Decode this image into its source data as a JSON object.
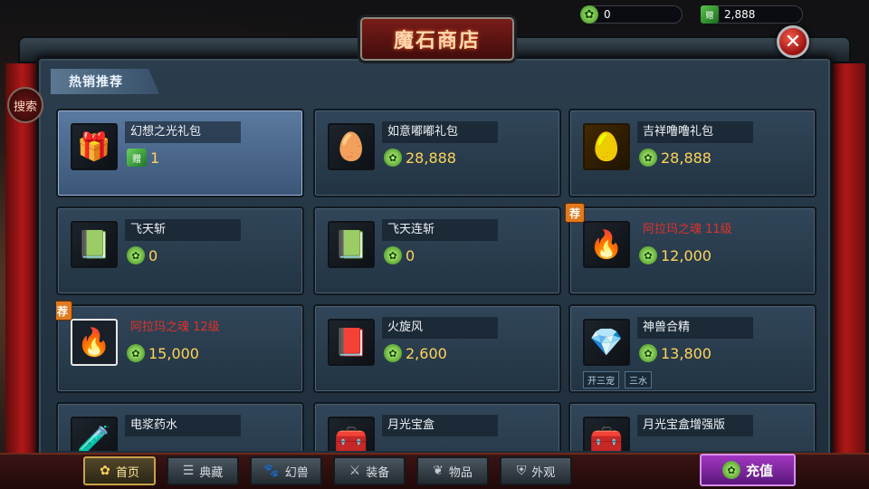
{
  "title": "魔石商店",
  "currency": {
    "gem": "0",
    "gift_gem": "2,888"
  },
  "search_label": "搜索",
  "section": "热销推荐",
  "colors": {
    "price": "#ffd35a",
    "red_name": "#e0322a",
    "badge": "#e07a1e",
    "recharge": "#a236c2"
  },
  "items": [
    {
      "name": "幻想之光礼包",
      "price": "1",
      "icon": "gift-box-icon",
      "currency": "gift",
      "selected": true
    },
    {
      "name": "如意嘟嘟礼包",
      "price": "28,888",
      "icon": "white-egg-icon"
    },
    {
      "name": "吉祥噜噜礼包",
      "price": "28,888",
      "icon": "golden-egg-icon"
    },
    {
      "name": "飞天斩",
      "price": "0",
      "icon": "skill-book-icon"
    },
    {
      "name": "飞天连斩",
      "price": "0",
      "icon": "skill-book-icon"
    },
    {
      "name": "阿拉玛之魂 11级",
      "price": "12,000",
      "icon": "red-soul-icon",
      "badge": "荐",
      "red": true
    },
    {
      "name": "阿拉玛之魂 12级",
      "price": "15,000",
      "icon": "red-soul-icon",
      "badge": "荐",
      "red": true,
      "highlight": true
    },
    {
      "name": "火旋风",
      "price": "2,600",
      "icon": "red-book-icon"
    },
    {
      "name": "神兽合精",
      "price": "13,800",
      "icon": "purple-crystal-icon",
      "tags": [
        "开三宠",
        "三水"
      ]
    },
    {
      "name": "电浆药水",
      "price": "",
      "icon": "potion-icon"
    },
    {
      "name": "月光宝盒",
      "price": "",
      "icon": "treasure-chest-icon"
    },
    {
      "name": "月光宝盒增强版",
      "price": "",
      "icon": "treasure-chest-icon"
    }
  ],
  "tabs": [
    {
      "label": "首页",
      "icon": "flower-icon",
      "active": true
    },
    {
      "label": "典藏",
      "icon": "scroll-icon"
    },
    {
      "label": "幻兽",
      "icon": "beast-icon"
    },
    {
      "label": "装备",
      "icon": "sword-icon"
    },
    {
      "label": "物品",
      "icon": "leaf-icon"
    },
    {
      "label": "外观",
      "icon": "armor-icon"
    }
  ],
  "recharge_label": "充值",
  "gift_tag": "赠"
}
